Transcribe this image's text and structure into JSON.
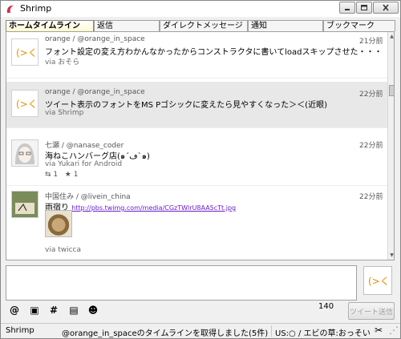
{
  "window": {
    "title": "Shrimp"
  },
  "tabs": [
    {
      "label": "ホームタイムライン",
      "active": true
    },
    {
      "label": "返信",
      "active": false
    },
    {
      "label": "ダイレクトメッセージ",
      "active": false
    },
    {
      "label": "通知",
      "active": false
    },
    {
      "label": "ブックマーク",
      "active": false
    }
  ],
  "tweets": [
    {
      "user": "orange / @orange_in_space",
      "time": "21分前",
      "text": "フォント設定の変え方わかんなかったからコンストラクタに書いてloadスキップさせた・・・＞＜",
      "via": "via おそら",
      "avatar_text": "(>く"
    },
    {
      "user": "orange / @orange_in_space",
      "time": "22分前",
      "text": "ツイート表示のフォントをMS Pゴシックに変えたら見やすくなった＞＜(近眼)",
      "via": "via Shrimp",
      "avatar_text": "(>く"
    },
    {
      "user": "七瀬 / @nanase_coder",
      "time": "22分前",
      "text": "海ねこハンバーグ店(๑´ڡ`๑)",
      "via": "via Yukari for Android",
      "retweets": "1",
      "favorites": "1"
    },
    {
      "user": "中国住み / @livein_china",
      "time": "22分前",
      "text_prefix": "雨宿り",
      "link": "http://pbs.twimg.com/media/CGzTWlrU8AA5cTt.jpg",
      "via": "via twicca"
    }
  ],
  "compose": {
    "char_count": "140",
    "send_label": "ツイート送信",
    "avatar_text": "(>く"
  },
  "toolbar": {
    "icons": [
      "at-icon",
      "image-icon",
      "hashtag-icon",
      "document-icon",
      "user-icon"
    ],
    "glyphs": [
      "@",
      "▣",
      "#",
      "▤",
      "☻"
    ]
  },
  "status": {
    "app": "Shrimp",
    "message": "@orange_in_spaceのタイムラインを取得しました(5件)",
    "info": "US:○ / エビの草:おっそい"
  }
}
